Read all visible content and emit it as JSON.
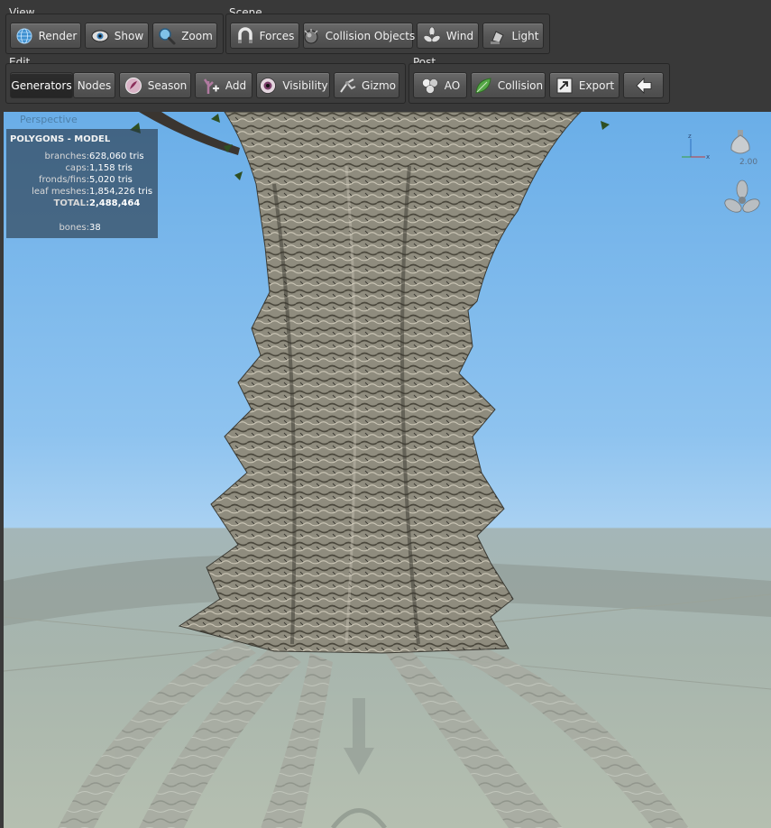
{
  "toolbar": {
    "groups": {
      "view": "View",
      "scene": "Scene",
      "edit": "Edit",
      "post": "Post"
    },
    "view_buttons": [
      {
        "label": "Render",
        "icon": "globe-icon"
      },
      {
        "label": "Show",
        "icon": "eye-icon"
      },
      {
        "label": "Zoom",
        "icon": "magnifier-icon"
      }
    ],
    "scene_buttons": [
      {
        "label": "Forces",
        "icon": "magnet-icon"
      },
      {
        "label": "Collision Objects",
        "icon": "sphere-icon"
      },
      {
        "label": "Wind",
        "icon": "fan-icon"
      },
      {
        "label": "Light",
        "icon": "lamp-icon"
      }
    ],
    "edit_buttons": [
      {
        "label": "Generators",
        "active": true
      },
      {
        "label": "Nodes",
        "active": false
      },
      {
        "label": "Season",
        "icon": "season-icon"
      },
      {
        "label": "Add",
        "icon": "add-branch-icon"
      },
      {
        "label": "Visibility",
        "icon": "visibility-eye-icon"
      },
      {
        "label": "Gizmo",
        "icon": "gizmo-icon"
      }
    ],
    "post_buttons": [
      {
        "label": "AO",
        "icon": "ao-spheres-icon"
      },
      {
        "label": "Collision",
        "icon": "leaf-icon"
      },
      {
        "label": "Export",
        "icon": "export-icon"
      },
      {
        "label": "",
        "icon": "back-arrow-icon"
      }
    ]
  },
  "viewport": {
    "mode_label": "Perspective",
    "stats": {
      "header": "POLYGONS - MODEL",
      "rows": [
        {
          "key": "branches:",
          "value": "628,060 tris"
        },
        {
          "key": "caps:",
          "value": "1,158 tris"
        },
        {
          "key": "fronds/fins:",
          "value": "5,020 tris"
        },
        {
          "key": "leaf meshes:",
          "value": "1,854,226 tris"
        },
        {
          "key": "TOTAL:",
          "value": "2,488,464"
        },
        {
          "key": "bones:",
          "value": "38"
        }
      ]
    },
    "light_intensity": "2.00",
    "axis": {
      "z": "z",
      "x": "x"
    },
    "colors": {
      "sky_top": "#6aaee8",
      "ground": "#a7b5ad",
      "bark": "#8c8a7c"
    }
  }
}
